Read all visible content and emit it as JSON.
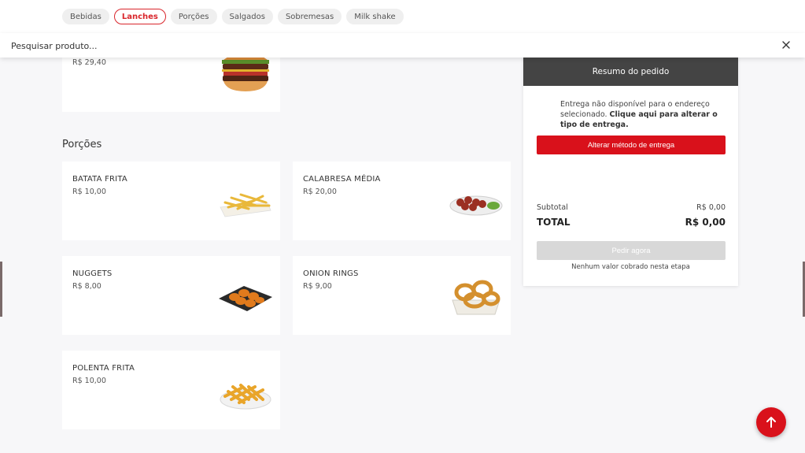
{
  "categories": [
    {
      "label": "Bebidas",
      "active": false
    },
    {
      "label": "Lanches",
      "active": true
    },
    {
      "label": "Porções",
      "active": false
    },
    {
      "label": "Salgados",
      "active": false
    },
    {
      "label": "Sobremesas",
      "active": false
    },
    {
      "label": "Milk shake",
      "active": false
    }
  ],
  "search": {
    "placeholder": "Pesquisar produto..."
  },
  "lanches": {
    "items": [
      {
        "price": "R$ 29,40",
        "image_icon": "burger-image"
      }
    ]
  },
  "porcoes": {
    "title": "Porções",
    "items": [
      {
        "name": "BATATA FRITA",
        "price": "R$ 10,00",
        "image_icon": "fries-image"
      },
      {
        "name": "CALABRESA MÉDIA",
        "price": "R$ 20,00",
        "image_icon": "calabresa-image"
      },
      {
        "name": "NUGGETS",
        "price": "R$ 8,00",
        "image_icon": "nuggets-image"
      },
      {
        "name": "ONION RINGS",
        "price": "R$ 9,00",
        "image_icon": "onion-rings-image"
      },
      {
        "name": "POLENTA FRITA",
        "price": "R$ 10,00",
        "image_icon": "polenta-image"
      }
    ]
  },
  "summary": {
    "title": "Resumo do pedido",
    "delivery_text": "Entrega não disponível para o endereço selecionado.",
    "delivery_link": "Clique aqui para alterar o tipo de entrega.",
    "change_delivery_label": "Alterar método de entrega",
    "subtotal_label": "Subtotal",
    "subtotal_value": "R$ 0,00",
    "total_label": "TOTAL",
    "total_value": "R$ 0,00",
    "order_button_label": "Pedir agora",
    "note": "Nenhum valor cobrado nesta etapa"
  },
  "colors": {
    "accent": "#d9111b",
    "summary_header": "#444444",
    "background": "#f7f7f9"
  }
}
